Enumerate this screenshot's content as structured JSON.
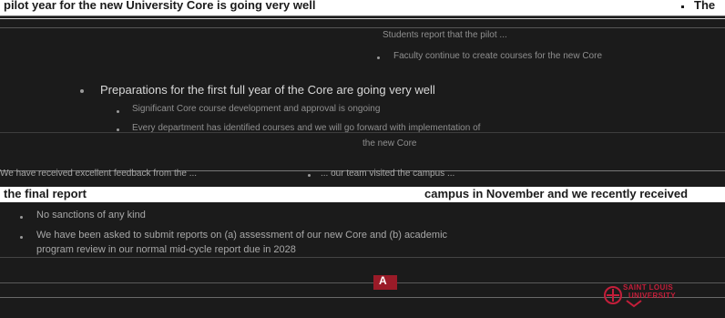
{
  "slide_top": {
    "heading": "pilot year for the new University Core is going very well",
    "bullet_the": "The"
  },
  "block1": {
    "line_a": "Students report that the pilot ...",
    "line_b": "Faculty continue to create courses for the new Core",
    "heading": "Preparations for the first full year of the Core are going very well",
    "line_c": "Significant Core course development and approval is ongoing",
    "line_d": "Every department has identified courses and we will go forward with implementation of",
    "line_e": "the new Core"
  },
  "band_mid": {
    "left_text": "We have received excellent feedback from the ...",
    "right_text": "... our team visited the campus ...",
    "bottom_left": "the final report",
    "bottom_right": "campus in November and we recently received"
  },
  "block2": {
    "line_a": "No sanctions of any kind",
    "line_b": "We have been asked to submit reports on (a) assessment of our new Core and (b) academic",
    "line_c": "program review in our normal mid-cycle report due in 2028"
  },
  "logo": {
    "initials": "A",
    "slu_line1": "SAINT LOUIS",
    "slu_line2": "UNIVERSITY"
  }
}
